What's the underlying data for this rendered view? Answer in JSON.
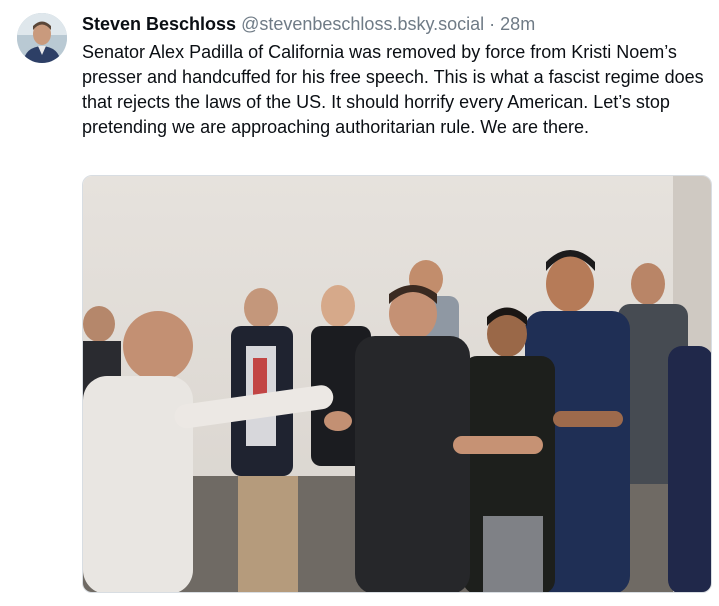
{
  "post": {
    "author": {
      "display_name": "Steven Beschloss",
      "handle": "@stevenbeschloss.bsky.social",
      "separator": "·",
      "time": "28m"
    },
    "text": "Senator Alex Padilla of California was removed by force from Kristi Noem’s presser and handcuffed for his free speech. This is what a fascist regime does that rejects the laws of the US. It should horrify every American. Let’s stop pretending we are approaching authoritarian rule. We are there.",
    "media": {
      "kind": "photo"
    }
  }
}
